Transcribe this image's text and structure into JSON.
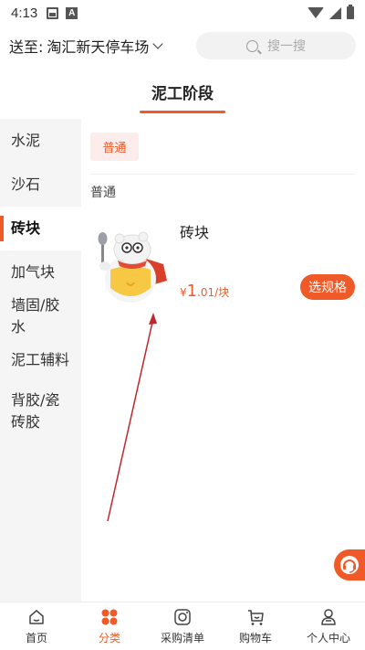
{
  "status_bar": {
    "time": "4:13"
  },
  "header": {
    "delivery_prefix": "送至:",
    "delivery_location": "淘汇新天停车场",
    "search_placeholder": "搜一搜"
  },
  "stage": {
    "title": "泥工阶段"
  },
  "sidebar": {
    "items": [
      {
        "label": "水泥"
      },
      {
        "label": "沙石"
      },
      {
        "label": "砖块",
        "active": true
      },
      {
        "label": "加气块"
      },
      {
        "label": "墙固/胶水"
      },
      {
        "label": "泥工辅料"
      },
      {
        "label": "背胶/瓷砖胶"
      }
    ]
  },
  "content": {
    "chip_label": "普通",
    "group_label": "普通",
    "product": {
      "name": "砖块",
      "price_symbol": "¥",
      "price_int": "1",
      "price_rest": ".01/块",
      "spec_button": "选规格"
    }
  },
  "bottom_nav": {
    "items": [
      {
        "label": "首页",
        "icon": "home-icon"
      },
      {
        "label": "分类",
        "icon": "category-icon",
        "active": true
      },
      {
        "label": "采购清单",
        "icon": "purchase-list-icon"
      },
      {
        "label": "购物车",
        "icon": "cart-icon"
      },
      {
        "label": "个人中心",
        "icon": "profile-icon"
      }
    ]
  },
  "colors": {
    "accent": "#f05a28",
    "sidebar_bg": "#f5f5f5",
    "chip_bg": "#fdecec",
    "arrow": "#c0282d"
  }
}
